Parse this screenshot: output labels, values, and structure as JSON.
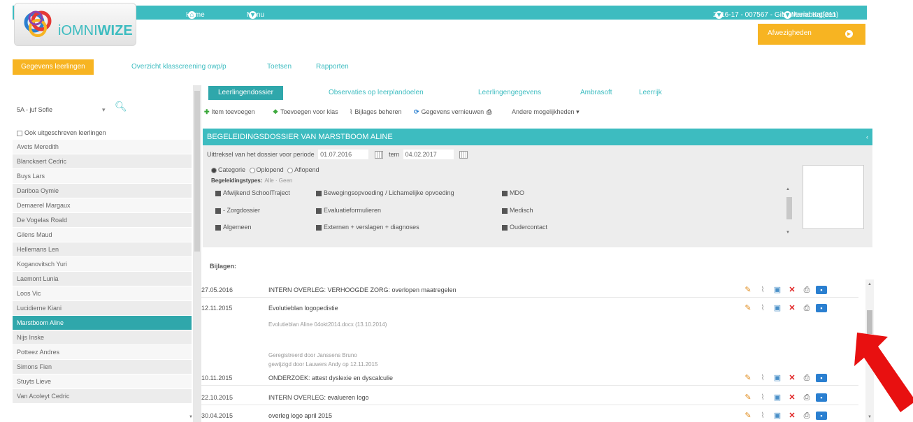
{
  "topbar": {
    "home": "Home",
    "menu": "Menu",
    "context": "2016-17 - 007567 - Gibo Mariaburg(211)",
    "user": "Marleens Katleen"
  },
  "logo": {
    "text_prefix": "iOMNI",
    "text_suffix": "WIZE"
  },
  "afwezigheden": {
    "label": "Afwezigheden"
  },
  "main_tabs": [
    "Gegevens leerlingen",
    "Overzicht klasscreening owp/p",
    "Toetsen",
    "Rapporten"
  ],
  "sidebar": {
    "class": "5A - juf Sofie",
    "ook_label": "Ook uitgeschreven leerlingen",
    "students": [
      "Avets Meredith",
      "Blanckaert Cedric",
      "Buys Lars",
      "Dariboa Oymie",
      "Demaerel Margaux",
      "De Vogelas Roald",
      "Gilens Maud",
      "Hellemans Len",
      "Koganovitsch Yuri",
      "Laemont Lunia",
      "Loos Vic",
      "Lucidierne Kiani",
      "Marstboom Aline",
      "Nijs Inske",
      "Potteez Andres",
      "Simons Fien",
      "Stuyts Lieve",
      "Van Acoleyt Cedric"
    ],
    "active_index": 12
  },
  "sub_tabs": [
    "Leerlingendossier",
    "Observaties op leerplandoelen",
    "Leerlingengegevens",
    "Ambrasoft",
    "Leerrijk"
  ],
  "toolbar": {
    "add_item": "Item toevoegen",
    "add_class": "Toevoegen voor klas",
    "manage_attachments": "Bijlages beheren",
    "refresh": "Gegevens vernieuwen",
    "other": "Andere mogelijkheden"
  },
  "dossier_title": "BEGELEIDINGSDOSSIER VAN MARSTBOOM ALINE",
  "filter": {
    "uittreksel_label": "Uittreksel van het dossier voor periode",
    "date_from": "01.07.2016",
    "tem_label": "tem",
    "date_to": "04.02.2017",
    "radios": [
      "Categorie",
      "Oplopend",
      "Aflopend"
    ],
    "types_label": "Begeleidingstypes:",
    "types_sub": "Alle · Geen",
    "types": [
      "Afwijkend SchoolTraject",
      "Bewegingsopvoeding / Lichamelijke opvoeding",
      "MDO",
      "- Zorgdossier",
      "Evaluatieformulieren",
      "Medisch",
      "Algemeen",
      "Externen + verslagen + diagnoses",
      "Oudercontact"
    ]
  },
  "bijlagen_label": "Bijlagen:",
  "attachments": [
    {
      "date": "27.05.2016",
      "title": "INTERN OVERLEG: VERHOOGDE ZORG: overlopen maatregelen"
    },
    {
      "date": "12.11.2015",
      "title": "Evolutieblan logopedistie"
    },
    {
      "date": "10.11.2015",
      "title": "ONDERZOEK: attest dyslexie en dyscalculie"
    },
    {
      "date": "22.10.2015",
      "title": "INTERN OVERLEG: evalueren logo"
    },
    {
      "date": "30.04.2015",
      "title": "overleg logo april 2015"
    }
  ],
  "attachment_details": [
    "Evolutieblan Aline 04okt2014.docx (13.10.2014)",
    "Geregistreerd door Janssens Bruno",
    "gewijzigd door Lauwers Andy op 12.11.2015"
  ],
  "colors": {
    "teal": "#3dbcc0",
    "orange": "#f7b422",
    "active_row": "#2fa7ab",
    "arrow": "#e81010"
  }
}
